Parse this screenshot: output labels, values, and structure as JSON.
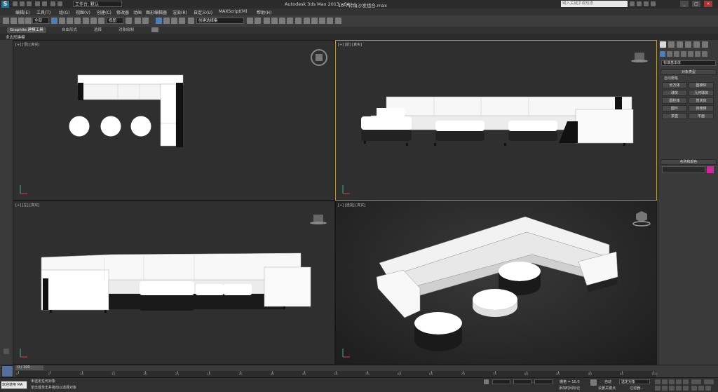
{
  "titlebar": {
    "app_logo": "S",
    "workspace_label": "工作台: 默认",
    "app_title": "Autodesk 3ds Max  2013 x64",
    "file_title": "10-7转角沙发组合.max",
    "search_placeholder": "键入关键字或短语",
    "win_min": "_",
    "win_max": "□",
    "win_close": "×"
  },
  "menubar": {
    "items": [
      "编辑(E)",
      "工具(T)",
      "组(G)",
      "视图(V)",
      "创建(C)",
      "修改器",
      "动画",
      "图形编辑器",
      "渲染(R)",
      "自定义(U)",
      "MAXScript(M)",
      "帮助(H)"
    ]
  },
  "toolbar": {
    "filter_select": "全部",
    "view_select": "视图",
    "named_selection": "创建选择集"
  },
  "ribbon": {
    "tabs": [
      "Graphite 建模工具",
      "自由形式",
      "选择",
      "对象绘制"
    ],
    "sub_label": "多边形建模"
  },
  "viewports": {
    "top_left": {
      "label": "[+] [顶] [真实]"
    },
    "top_right": {
      "label": "[+] [前] [真实]"
    },
    "bottom_left": {
      "label": "[+] [左] [真实]"
    },
    "bottom_right": {
      "label": "[+] [透视] [真实]"
    }
  },
  "command_panel": {
    "category_dropdown": "标准基本体",
    "object_type_title": "对象类型",
    "autogrid_label": "自动栅格",
    "buttons": [
      "长方体",
      "圆锥体",
      "球体",
      "几何球体",
      "圆柱体",
      "管状体",
      "圆环",
      "四棱锥",
      "茶壶",
      "平面"
    ],
    "name_color_title": "名称和颜色",
    "object_color": "#cc2a9a"
  },
  "timeline": {
    "frame_counter": "0 / 100",
    "ticks": [
      "0",
      "5",
      "10",
      "15",
      "20",
      "25",
      "30",
      "35",
      "40",
      "45",
      "50",
      "55",
      "60",
      "65",
      "70",
      "75",
      "80",
      "85",
      "90",
      "95",
      "100"
    ]
  },
  "statusbar": {
    "mini_listener": "欢迎使用 MA",
    "status_line1": "未选定任何对象",
    "status_line2": "单击或单击并拖动以选择对象",
    "grid_label": "栅格 = 10.0",
    "auto_key_label": "自动",
    "add_time_tag": "添加时间标记",
    "set_key_label": "设置关键点",
    "selected_dropdown": "选定对象",
    "key_filters": "过滤器..."
  }
}
